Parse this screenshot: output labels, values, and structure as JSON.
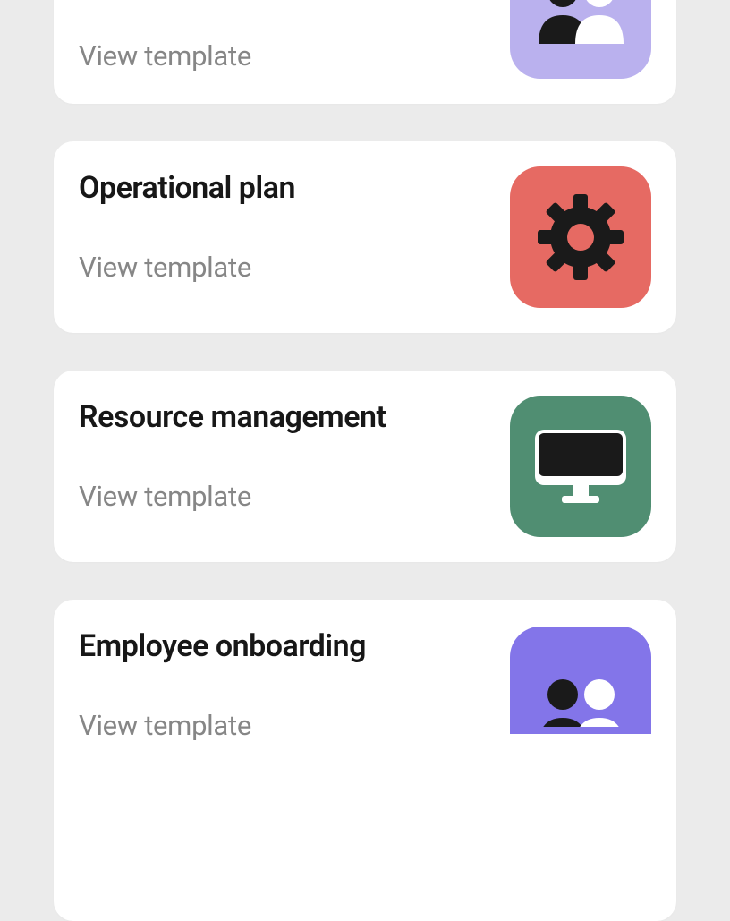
{
  "cards": [
    {
      "title": "",
      "link_label": "View template",
      "icon": "people-icon",
      "tile_color": "lilac"
    },
    {
      "title": "Operational plan",
      "link_label": "View template",
      "icon": "gear-icon",
      "tile_color": "red"
    },
    {
      "title": "Resource management",
      "link_label": "View template",
      "icon": "monitor-icon",
      "tile_color": "green"
    },
    {
      "title": "Employee onboarding",
      "link_label": "View template",
      "icon": "people-icon",
      "tile_color": "violet"
    }
  ]
}
